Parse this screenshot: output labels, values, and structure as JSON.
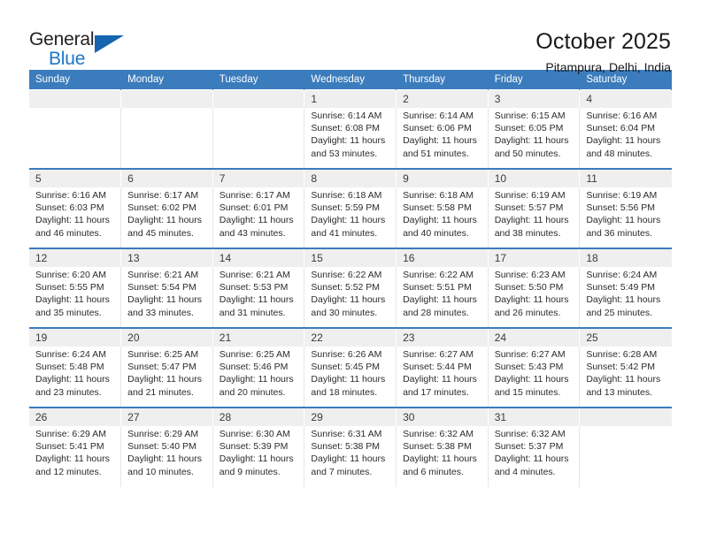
{
  "brand": {
    "name_part1": "General",
    "name_part2": "Blue",
    "logo_icon": "triangle-flag-icon",
    "accent_color": "#1565b0"
  },
  "header": {
    "title": "October 2025",
    "subtitle": "Pitampura, Delhi, India"
  },
  "theme": {
    "header_row_color": "#3b7cbd",
    "daynum_band_color": "#efefef",
    "text_color": "#2b2b2b"
  },
  "calendar": {
    "weekday_headers": [
      "Sunday",
      "Monday",
      "Tuesday",
      "Wednesday",
      "Thursday",
      "Friday",
      "Saturday"
    ],
    "weeks": [
      [
        {
          "day": "",
          "lines": []
        },
        {
          "day": "",
          "lines": []
        },
        {
          "day": "",
          "lines": []
        },
        {
          "day": "1",
          "lines": [
            "Sunrise: 6:14 AM",
            "Sunset: 6:08 PM",
            "Daylight: 11 hours",
            "and 53 minutes."
          ]
        },
        {
          "day": "2",
          "lines": [
            "Sunrise: 6:14 AM",
            "Sunset: 6:06 PM",
            "Daylight: 11 hours",
            "and 51 minutes."
          ]
        },
        {
          "day": "3",
          "lines": [
            "Sunrise: 6:15 AM",
            "Sunset: 6:05 PM",
            "Daylight: 11 hours",
            "and 50 minutes."
          ]
        },
        {
          "day": "4",
          "lines": [
            "Sunrise: 6:16 AM",
            "Sunset: 6:04 PM",
            "Daylight: 11 hours",
            "and 48 minutes."
          ]
        }
      ],
      [
        {
          "day": "5",
          "lines": [
            "Sunrise: 6:16 AM",
            "Sunset: 6:03 PM",
            "Daylight: 11 hours",
            "and 46 minutes."
          ]
        },
        {
          "day": "6",
          "lines": [
            "Sunrise: 6:17 AM",
            "Sunset: 6:02 PM",
            "Daylight: 11 hours",
            "and 45 minutes."
          ]
        },
        {
          "day": "7",
          "lines": [
            "Sunrise: 6:17 AM",
            "Sunset: 6:01 PM",
            "Daylight: 11 hours",
            "and 43 minutes."
          ]
        },
        {
          "day": "8",
          "lines": [
            "Sunrise: 6:18 AM",
            "Sunset: 5:59 PM",
            "Daylight: 11 hours",
            "and 41 minutes."
          ]
        },
        {
          "day": "9",
          "lines": [
            "Sunrise: 6:18 AM",
            "Sunset: 5:58 PM",
            "Daylight: 11 hours",
            "and 40 minutes."
          ]
        },
        {
          "day": "10",
          "lines": [
            "Sunrise: 6:19 AM",
            "Sunset: 5:57 PM",
            "Daylight: 11 hours",
            "and 38 minutes."
          ]
        },
        {
          "day": "11",
          "lines": [
            "Sunrise: 6:19 AM",
            "Sunset: 5:56 PM",
            "Daylight: 11 hours",
            "and 36 minutes."
          ]
        }
      ],
      [
        {
          "day": "12",
          "lines": [
            "Sunrise: 6:20 AM",
            "Sunset: 5:55 PM",
            "Daylight: 11 hours",
            "and 35 minutes."
          ]
        },
        {
          "day": "13",
          "lines": [
            "Sunrise: 6:21 AM",
            "Sunset: 5:54 PM",
            "Daylight: 11 hours",
            "and 33 minutes."
          ]
        },
        {
          "day": "14",
          "lines": [
            "Sunrise: 6:21 AM",
            "Sunset: 5:53 PM",
            "Daylight: 11 hours",
            "and 31 minutes."
          ]
        },
        {
          "day": "15",
          "lines": [
            "Sunrise: 6:22 AM",
            "Sunset: 5:52 PM",
            "Daylight: 11 hours",
            "and 30 minutes."
          ]
        },
        {
          "day": "16",
          "lines": [
            "Sunrise: 6:22 AM",
            "Sunset: 5:51 PM",
            "Daylight: 11 hours",
            "and 28 minutes."
          ]
        },
        {
          "day": "17",
          "lines": [
            "Sunrise: 6:23 AM",
            "Sunset: 5:50 PM",
            "Daylight: 11 hours",
            "and 26 minutes."
          ]
        },
        {
          "day": "18",
          "lines": [
            "Sunrise: 6:24 AM",
            "Sunset: 5:49 PM",
            "Daylight: 11 hours",
            "and 25 minutes."
          ]
        }
      ],
      [
        {
          "day": "19",
          "lines": [
            "Sunrise: 6:24 AM",
            "Sunset: 5:48 PM",
            "Daylight: 11 hours",
            "and 23 minutes."
          ]
        },
        {
          "day": "20",
          "lines": [
            "Sunrise: 6:25 AM",
            "Sunset: 5:47 PM",
            "Daylight: 11 hours",
            "and 21 minutes."
          ]
        },
        {
          "day": "21",
          "lines": [
            "Sunrise: 6:25 AM",
            "Sunset: 5:46 PM",
            "Daylight: 11 hours",
            "and 20 minutes."
          ]
        },
        {
          "day": "22",
          "lines": [
            "Sunrise: 6:26 AM",
            "Sunset: 5:45 PM",
            "Daylight: 11 hours",
            "and 18 minutes."
          ]
        },
        {
          "day": "23",
          "lines": [
            "Sunrise: 6:27 AM",
            "Sunset: 5:44 PM",
            "Daylight: 11 hours",
            "and 17 minutes."
          ]
        },
        {
          "day": "24",
          "lines": [
            "Sunrise: 6:27 AM",
            "Sunset: 5:43 PM",
            "Daylight: 11 hours",
            "and 15 minutes."
          ]
        },
        {
          "day": "25",
          "lines": [
            "Sunrise: 6:28 AM",
            "Sunset: 5:42 PM",
            "Daylight: 11 hours",
            "and 13 minutes."
          ]
        }
      ],
      [
        {
          "day": "26",
          "lines": [
            "Sunrise: 6:29 AM",
            "Sunset: 5:41 PM",
            "Daylight: 11 hours",
            "and 12 minutes."
          ]
        },
        {
          "day": "27",
          "lines": [
            "Sunrise: 6:29 AM",
            "Sunset: 5:40 PM",
            "Daylight: 11 hours",
            "and 10 minutes."
          ]
        },
        {
          "day": "28",
          "lines": [
            "Sunrise: 6:30 AM",
            "Sunset: 5:39 PM",
            "Daylight: 11 hours",
            "and 9 minutes."
          ]
        },
        {
          "day": "29",
          "lines": [
            "Sunrise: 6:31 AM",
            "Sunset: 5:38 PM",
            "Daylight: 11 hours",
            "and 7 minutes."
          ]
        },
        {
          "day": "30",
          "lines": [
            "Sunrise: 6:32 AM",
            "Sunset: 5:38 PM",
            "Daylight: 11 hours",
            "and 6 minutes."
          ]
        },
        {
          "day": "31",
          "lines": [
            "Sunrise: 6:32 AM",
            "Sunset: 5:37 PM",
            "Daylight: 11 hours",
            "and 4 minutes."
          ]
        },
        {
          "day": "",
          "lines": []
        }
      ]
    ]
  }
}
